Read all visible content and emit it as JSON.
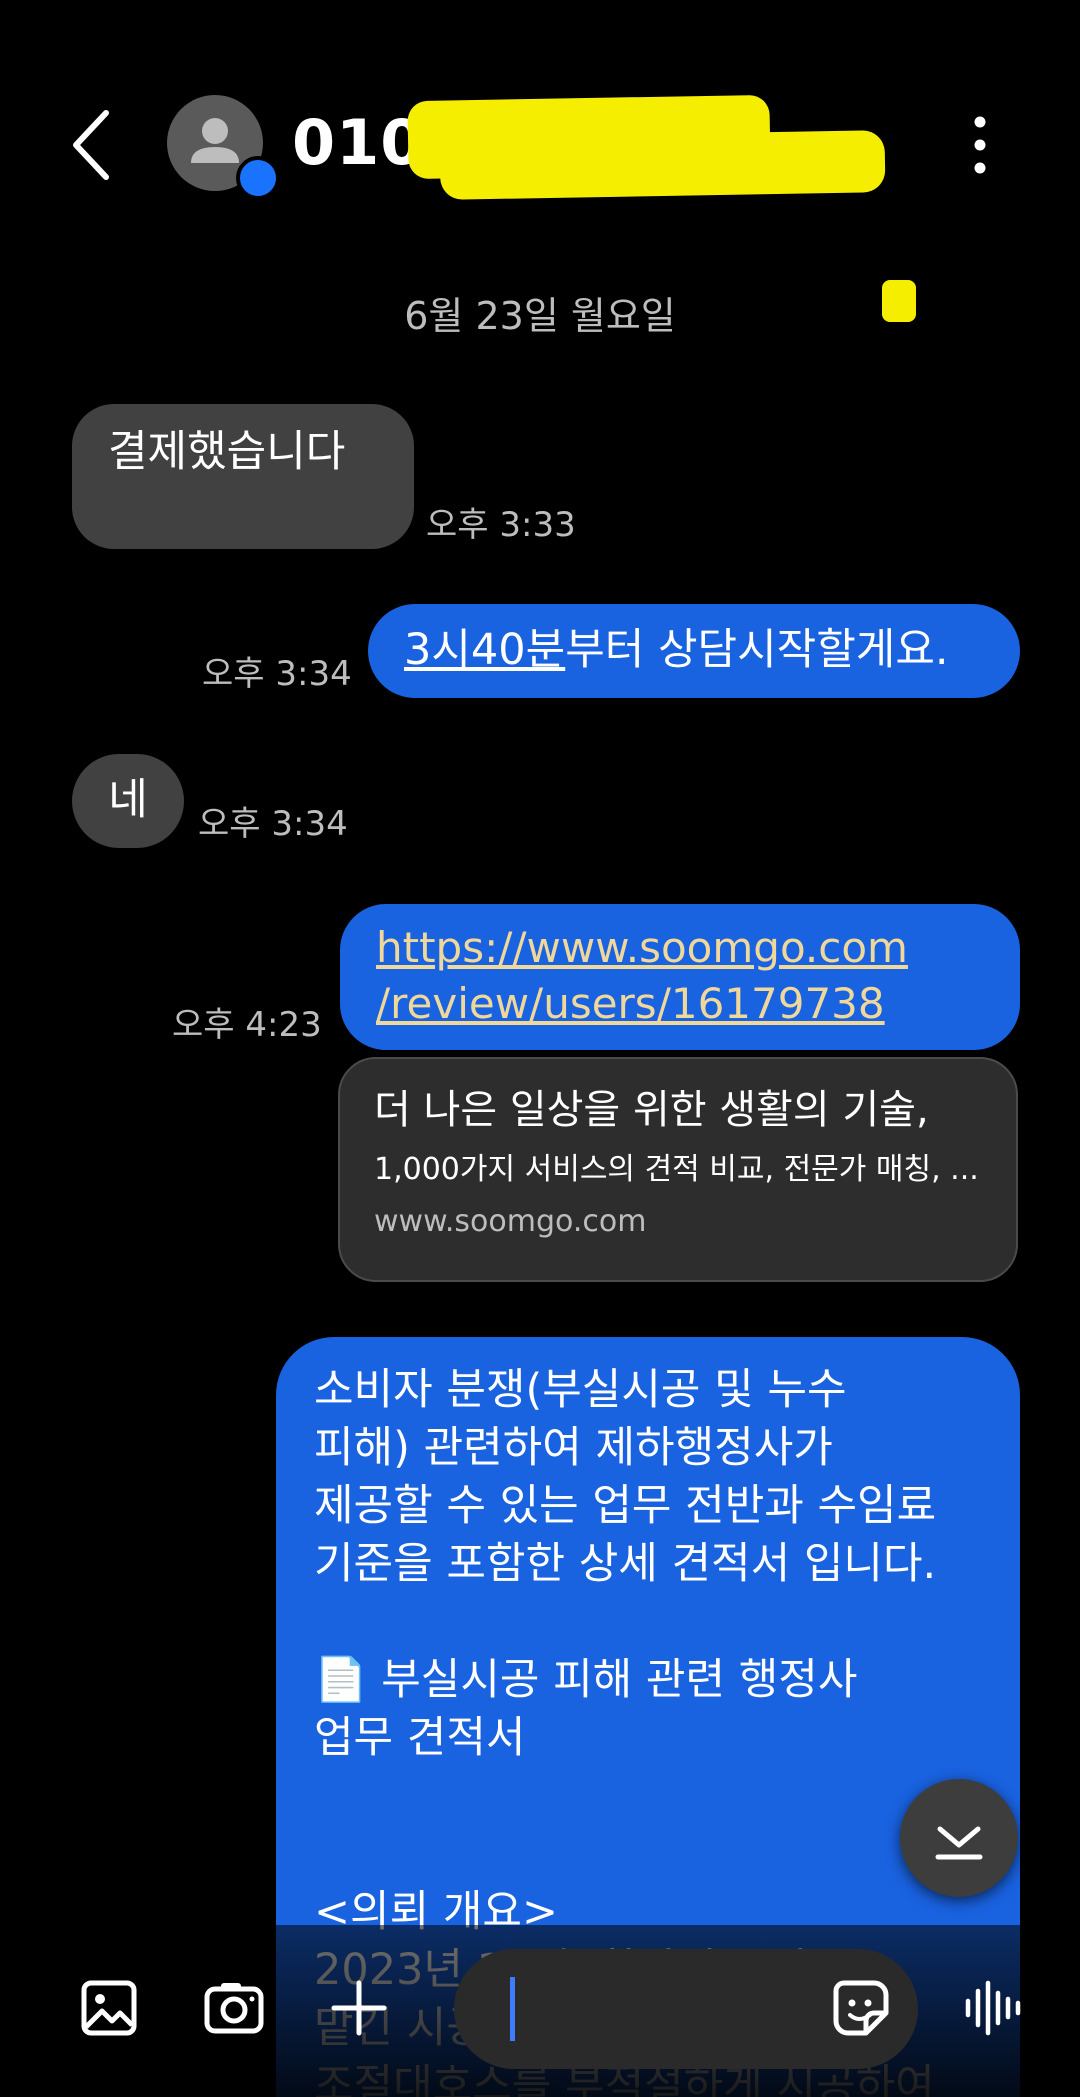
{
  "header": {
    "contact_number": "010-",
    "colors": {
      "redaction": "#f6ee00",
      "badge": "#1a73ff"
    }
  },
  "date_separator": "6월 23일 월요일",
  "messages": [
    {
      "direction": "in",
      "text": "결제했습니다",
      "time": "오후 3:33"
    },
    {
      "direction": "out",
      "text_link": "3시40분",
      "text_rest": "부터 상담시작할게요.",
      "time": "오후 3:34"
    },
    {
      "direction": "in",
      "text": "네",
      "time": "오후 3:34"
    },
    {
      "direction": "out",
      "link_line1": "https://www.soomgo.com",
      "link_line2": "/review/users/16179738",
      "time": "오후 4:23"
    }
  ],
  "link_preview": {
    "title": "더 나은 일상을 위한 생활의 기술,",
    "description": "1,000가지 서비스의 견적 비교, 전문가 매칭, ...",
    "domain": "www.soomgo.com"
  },
  "long_message": {
    "text": "소비자 분쟁(부실시공 및 누수\n피해) 관련하여 제하행정사가\n제공할 수 있는 업무 전반과 수임료\n기준을 포함한 상세 견적서 입니다.\n\n📄 부실시공 피해 관련 행정사\n업무 견적서\n\n\n<의뢰 개요>\n2023년 10월, 화장실 공사를\n맡긴 시공업자의 부실시공 및\n조절대호스를 부적절하게 시공하여"
  },
  "composer": {
    "placeholder": "",
    "icons": [
      "gallery-icon",
      "camera-icon",
      "plus-icon",
      "sticker-icon",
      "voice-icon"
    ]
  },
  "colors": {
    "outgoing_bubble": "#1962e0",
    "incoming_bubble": "#414141",
    "link_text": "#f0d79a",
    "background": "#000000"
  }
}
